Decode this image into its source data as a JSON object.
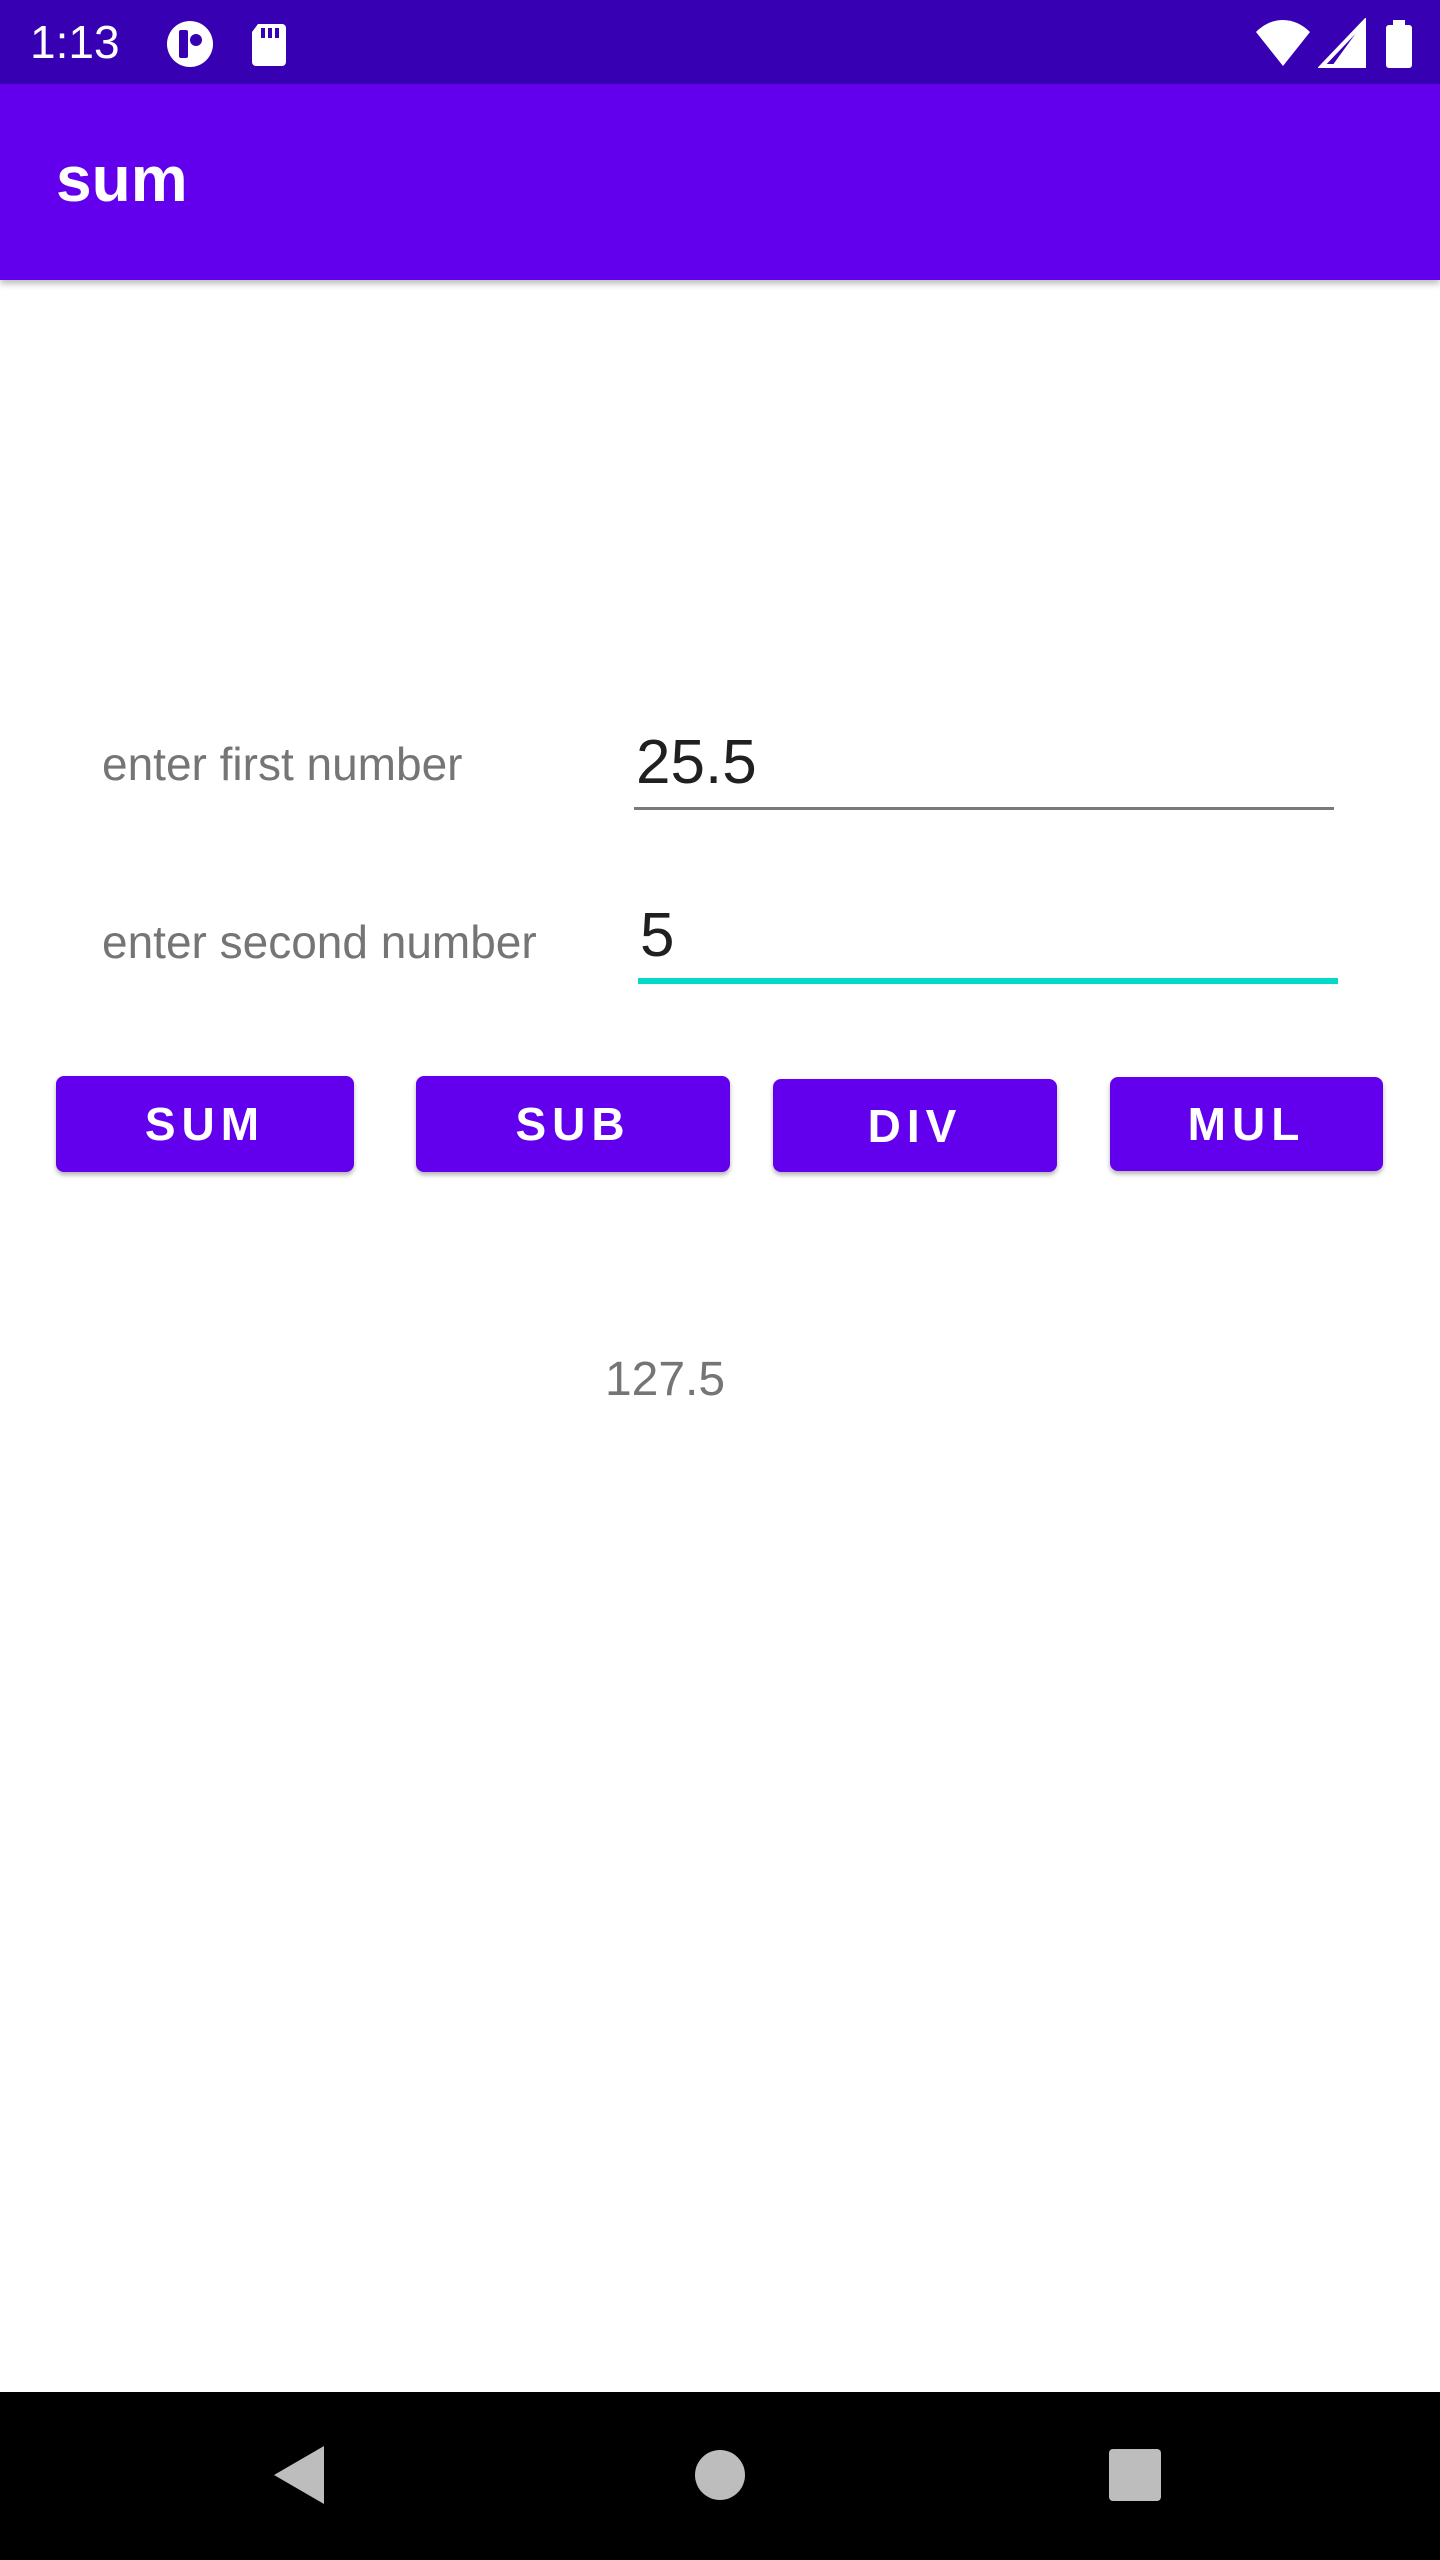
{
  "status_bar": {
    "time": "1:13",
    "icons": [
      "app-notification-icon",
      "sd-card-icon",
      "wifi-icon",
      "signal-icon",
      "battery-icon"
    ]
  },
  "app_bar": {
    "title": "sum"
  },
  "form": {
    "first": {
      "label": "enter first number",
      "value": "25.5"
    },
    "second": {
      "label": "enter second number",
      "value": "5"
    }
  },
  "buttons": {
    "sum": "SUM",
    "sub": "SUB",
    "div": "DIV",
    "mul": "MUL"
  },
  "result": "127.5",
  "nav_bar": {
    "icons": [
      "back-icon",
      "home-icon",
      "recents-icon"
    ]
  },
  "colors": {
    "status_bar": "#3700b3",
    "primary": "#6200ee",
    "accent": "#03dac5"
  }
}
